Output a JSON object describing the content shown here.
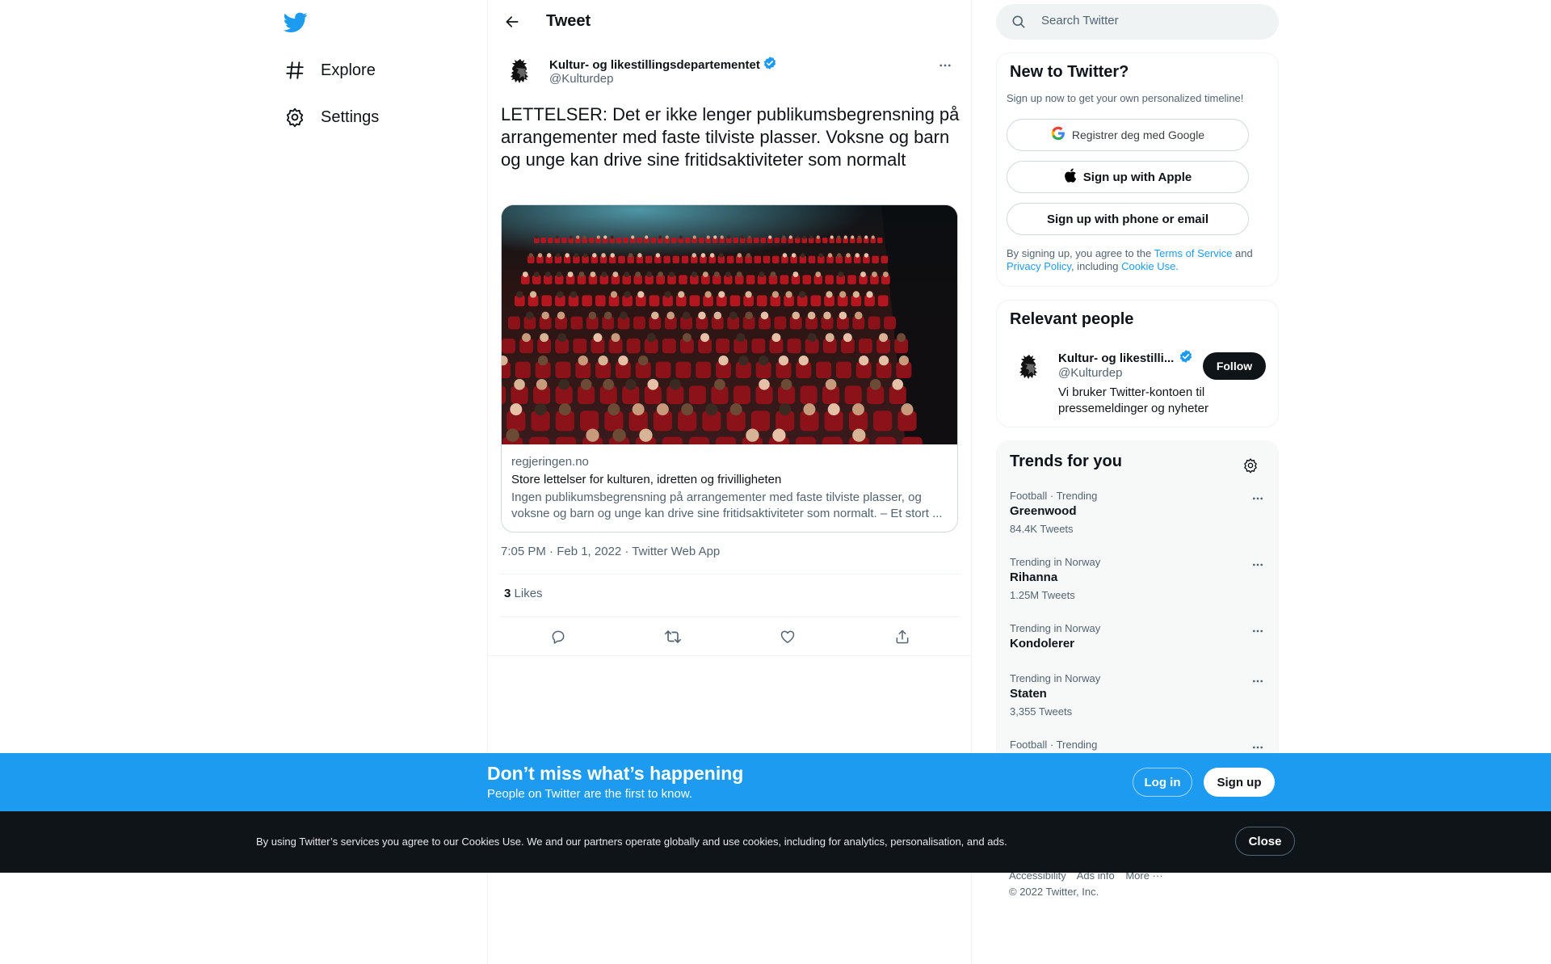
{
  "nav": {
    "items": [
      {
        "label": "Explore",
        "icon": "hashtag-icon"
      },
      {
        "label": "Settings",
        "icon": "gear-icon"
      }
    ]
  },
  "header": {
    "title": "Tweet"
  },
  "tweet": {
    "author_name": "Kultur- og likestillingsdepartementet",
    "author_handle": "@Kulturdep",
    "text": "LETTELSER: Det er ikke lenger publikumsbegrensning på arrangementer med faste tilviste plasser. Voksne og barn og unge kan drive sine fritidsaktiviteter som normalt",
    "card": {
      "domain": "regjeringen.no",
      "title": "Store lettelser for kulturen, idretten og frivilligheten",
      "description": "Ingen publikumsbegrensning på arrangementer med faste tilviste plasser, og voksne og barn og unge kan drive sine fritidsaktiviteter som normalt. – Et stort ..."
    },
    "time": "7:05 PM · Feb 1, 2022",
    "separator": " · ",
    "source": "Twitter Web App",
    "likes_count": "3",
    "likes_label": "Likes"
  },
  "search": {
    "placeholder": "Search Twitter"
  },
  "signup_panel": {
    "title": "New to Twitter?",
    "subtitle": "Sign up now to get your own personalized timeline!",
    "google_label": "Registrer deg med Google",
    "apple_label": "Sign up with Apple",
    "phone_label": "Sign up with phone or email",
    "legal_prefix": "By signing up, you agree to the ",
    "terms_link": "Terms of Service",
    "and_text": " and",
    "privacy_link": "Privacy Policy",
    "including_text": ", including ",
    "cookie_link": "Cookie Use."
  },
  "relevant_people": {
    "title": "Relevant people",
    "name": "Kultur- og likestilli...",
    "handle": "@Kulturdep",
    "bio": "Vi bruker Twitter-kontoen til pressemeldinger og nyheter",
    "follow_label": "Follow"
  },
  "trends": {
    "title": "Trends for you",
    "items": [
      {
        "category": "Football · Trending",
        "name": "Greenwood",
        "count": "84.4K Tweets"
      },
      {
        "category": "Trending in Norway",
        "name": "Rihanna",
        "count": "1.25M Tweets"
      },
      {
        "category": "Trending in Norway",
        "name": "Kondolerer",
        "count": ""
      },
      {
        "category": "Trending in Norway",
        "name": "Staten",
        "count": "3,355 Tweets"
      },
      {
        "category": "Football · Trending",
        "name": "",
        "count": ""
      }
    ]
  },
  "footer": {
    "links": [
      "Accessibility",
      "Ads info",
      "More ···"
    ],
    "copyright": "© 2022 Twitter, Inc."
  },
  "login_banner": {
    "headline": "Don’t miss what’s happening",
    "subline": "People on Twitter are the first to know.",
    "login_label": "Log in",
    "signup_label": "Sign up"
  },
  "cookie_banner": {
    "text": "By using Twitter’s services you agree to our Cookies Use. We and our partners operate globally and use cookies, including for analytics, personalisation, and ads.",
    "close_label": "Close"
  },
  "colors": {
    "brand_blue": "#1d9bf0",
    "text_primary": "#0f1419",
    "text_secondary": "#536471",
    "cookie_bg": "#0f1419"
  }
}
